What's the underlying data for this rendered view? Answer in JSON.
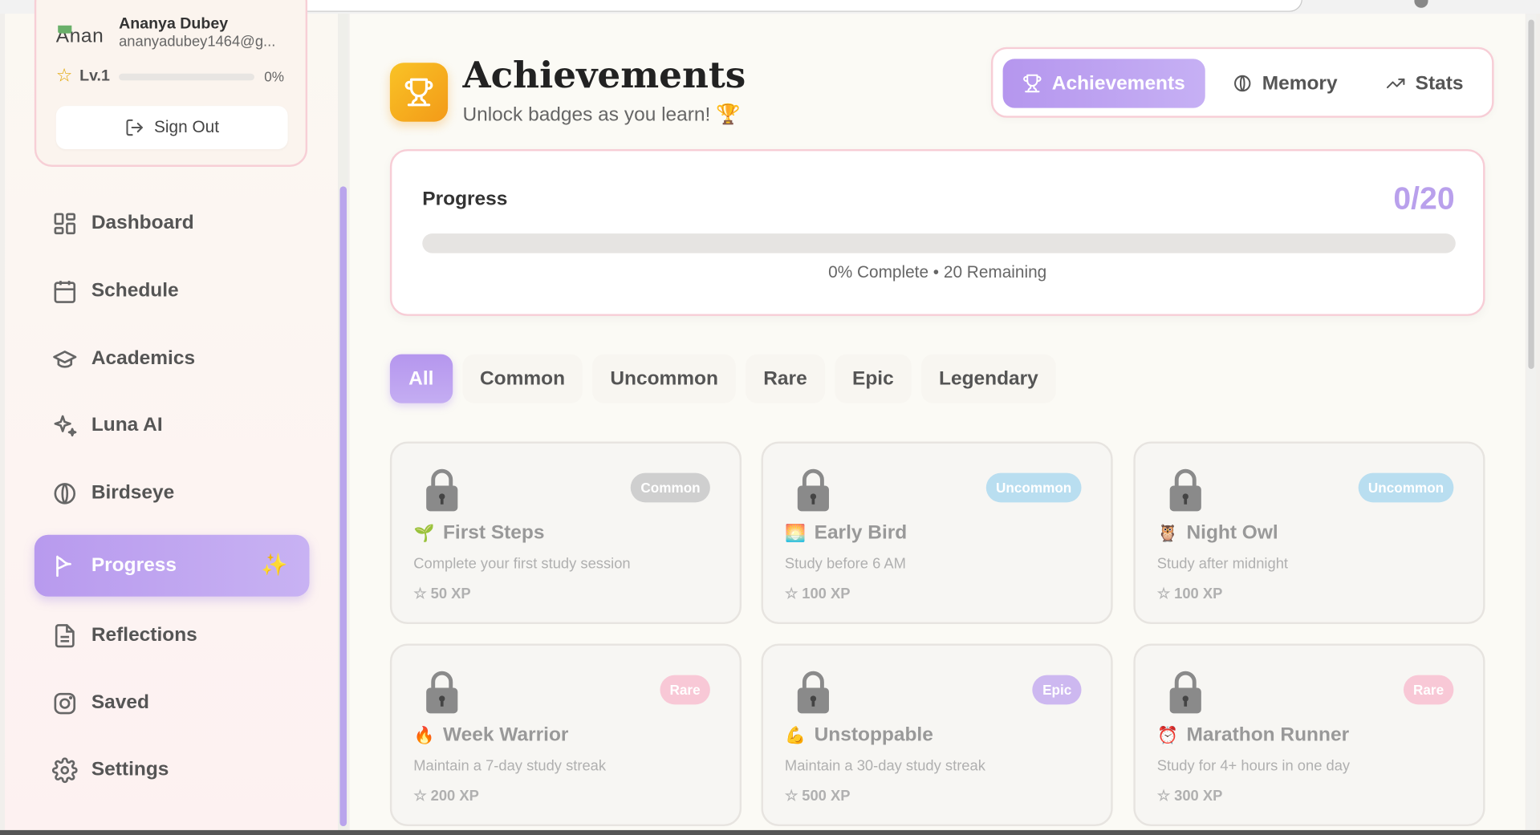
{
  "user": {
    "avatar_alt": "Anan",
    "name": "Ananya Dubey",
    "email": "ananyadubey1464@g...",
    "level": "Lv.1",
    "level_percent": "0%",
    "level_progress": 0,
    "sign_out": "Sign Out"
  },
  "nav": {
    "items": [
      {
        "label": "Dashboard",
        "icon": "dashboard-icon"
      },
      {
        "label": "Schedule",
        "icon": "calendar-icon"
      },
      {
        "label": "Academics",
        "icon": "graduation-cap-icon"
      },
      {
        "label": "Luna AI",
        "icon": "sparkles-icon"
      },
      {
        "label": "Birdseye",
        "icon": "leaf-icon"
      },
      {
        "label": "Progress",
        "icon": "progress-icon",
        "active": true
      },
      {
        "label": "Reflections",
        "icon": "document-icon"
      },
      {
        "label": "Saved",
        "icon": "saved-icon"
      },
      {
        "label": "Settings",
        "icon": "settings-icon"
      }
    ]
  },
  "header": {
    "title": "Achievements",
    "subtitle": "Unlock badges as you learn! 🏆"
  },
  "tabs": [
    {
      "label": "Achievements",
      "icon": "trophy-icon",
      "active": true
    },
    {
      "label": "Memory",
      "icon": "brain-icon"
    },
    {
      "label": "Stats",
      "icon": "trend-icon"
    }
  ],
  "progress": {
    "title": "Progress",
    "count": "0/20",
    "fraction": 0,
    "status": "0% Complete • 20 Remaining"
  },
  "filters": [
    "All",
    "Common",
    "Uncommon",
    "Rare",
    "Epic",
    "Legendary"
  ],
  "achievements": [
    {
      "emoji": "🌱",
      "title": "First Steps",
      "rarity": "Common",
      "description": "Complete your first study session",
      "xp": "50 XP"
    },
    {
      "emoji": "🌅",
      "title": "Early Bird",
      "rarity": "Uncommon",
      "description": "Study before 6 AM",
      "xp": "100 XP"
    },
    {
      "emoji": "🦉",
      "title": "Night Owl",
      "rarity": "Uncommon",
      "description": "Study after midnight",
      "xp": "100 XP"
    },
    {
      "emoji": "🔥",
      "title": "Week Warrior",
      "rarity": "Rare",
      "description": "Maintain a 7-day study streak",
      "xp": "200 XP"
    },
    {
      "emoji": "💪",
      "title": "Unstoppable",
      "rarity": "Epic",
      "description": "Maintain a 30-day study streak",
      "xp": "500 XP"
    },
    {
      "emoji": "⏰",
      "title": "Marathon Runner",
      "rarity": "Rare",
      "description": "Study for 4+ hours in one day",
      "xp": "300 XP"
    }
  ],
  "colors": {
    "accent": "#b89aee",
    "trophy": "#f5a81d",
    "border_pink": "#f7cdd6"
  }
}
